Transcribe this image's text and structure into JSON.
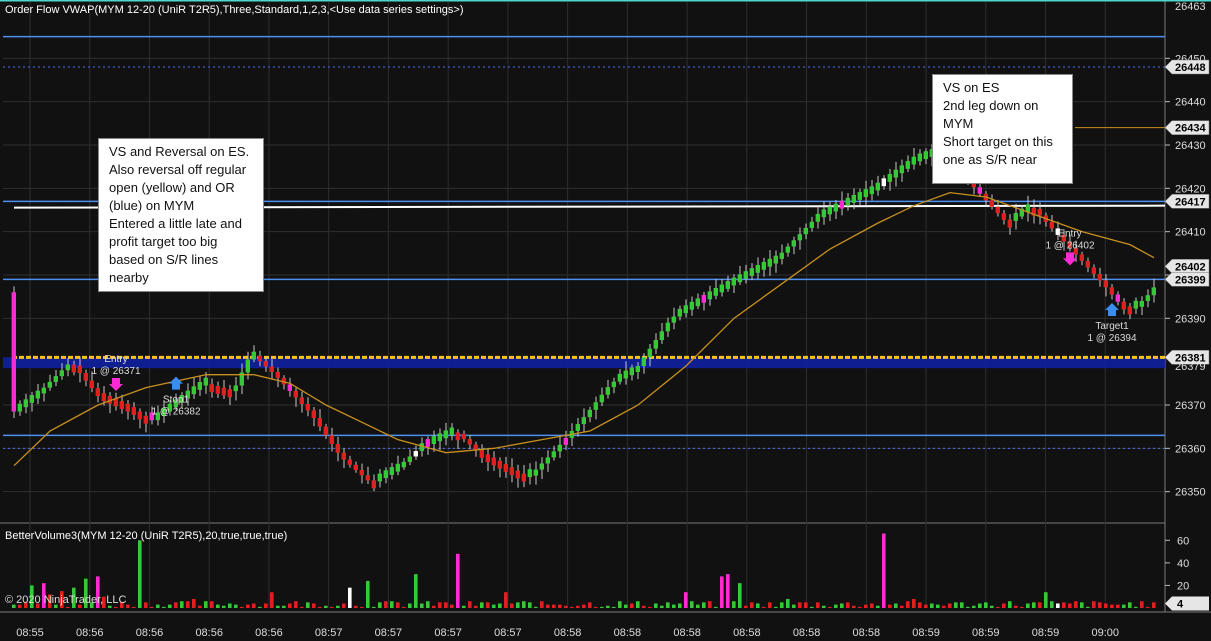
{
  "window": {
    "price_indicator_label": "Order Flow VWAP(MYM 12-20 (UniR T2R5),Three,Standard,1,2,3,<Use data series settings>)",
    "volume_indicator_label": "BetterVolume3(MYM 12-20 (UniR T2R5),20,true,true,true)",
    "copyright": "© 2020 NinjaTrader, LLC"
  },
  "colors": {
    "background": "#111111",
    "grid": "#2e2e2e",
    "up_bar": "#37c837",
    "down_bar": "#e02020",
    "climax_bar": "#ff2ad4",
    "neutral_bar": "#ffffff",
    "vwap": "#c8901e",
    "sr_line": "#4f8ff0",
    "open_line": "#ffc21a",
    "or_band": "#1020a0",
    "axis_tag_bg": "#e6e6e6",
    "note_bg": "#ffffff"
  },
  "notes": [
    {
      "id": "left",
      "text": "VS and Reversal on ES.\nAlso reversal off regular open (yellow) and OR (blue) on MYM\nEntered a little late and profit target too big based on S/R lines nearby"
    },
    {
      "id": "right",
      "text": "VS on ES\n2nd leg down on MYM\nShort target on this one as S/R near"
    }
  ],
  "trade_markers": [
    {
      "id": "entry-left",
      "label": "Entry",
      "detail": "1 @ 26371",
      "arrow": "down",
      "arrow_color": "#ff2ad4",
      "bar": 17,
      "price": 26373
    },
    {
      "id": "stop-left",
      "label": "Stop1",
      "detail": "1 @ 26382",
      "arrow": "up",
      "arrow_color": "#3a8ef0",
      "bar": 27,
      "price": 26377
    },
    {
      "id": "entry-right",
      "label": "Entry",
      "detail": "1 @ 26402",
      "arrow": "down",
      "arrow_color": "#ff2ad4",
      "bar": 176,
      "price": 26402
    },
    {
      "id": "target-right",
      "label": "Target1",
      "detail": "1 @ 26394",
      "arrow": "up",
      "arrow_color": "#3a8ef0",
      "bar": 183,
      "price": 26394
    }
  ],
  "chart_data": {
    "type": "candlestick",
    "y_range": [
      26343,
      26463
    ],
    "y_ticks": [
      26350,
      26360,
      26370,
      26390,
      26400,
      26410,
      26420,
      26430,
      26440,
      26450
    ],
    "price_tags": [
      {
        "value": 26463,
        "type": "plain"
      },
      {
        "value": 26448,
        "type": "tag"
      },
      {
        "value": 26434,
        "type": "tag"
      },
      {
        "value": 26417,
        "type": "tag"
      },
      {
        "value": 26402,
        "type": "tag"
      },
      {
        "value": 26399,
        "type": "tag"
      },
      {
        "value": 26381,
        "type": "tag"
      },
      {
        "value": 26379,
        "type": "plain"
      }
    ],
    "levels": [
      {
        "price": 26455,
        "style": "sr"
      },
      {
        "price": 26448,
        "style": "dotted"
      },
      {
        "price": 26434,
        "style": "vwap-right"
      },
      {
        "price": 26417,
        "style": "sr"
      },
      {
        "price": 26416,
        "style": "white"
      },
      {
        "price": 26399,
        "style": "sr"
      },
      {
        "price": 26381,
        "style": "open"
      },
      {
        "price": 26363,
        "style": "sr"
      },
      {
        "price": 26360,
        "style": "dotted"
      }
    ],
    "or_band": [
      26378.5,
      26381
    ],
    "x_labels": [
      "08:55",
      "08:56",
      "08:56",
      "08:56",
      "08:56",
      "08:57",
      "08:57",
      "08:57",
      "08:57",
      "08:58",
      "08:58",
      "08:58",
      "08:58",
      "08:58",
      "08:58",
      "08:59",
      "08:59",
      "08:59",
      "09:00"
    ],
    "path": [
      [
        0,
        26368
      ],
      [
        4,
        26372
      ],
      [
        10,
        26380
      ],
      [
        14,
        26373
      ],
      [
        19,
        26370
      ],
      [
        23,
        26366
      ],
      [
        28,
        26371
      ],
      [
        32,
        26375
      ],
      [
        37,
        26373
      ],
      [
        40,
        26382
      ],
      [
        44,
        26377
      ],
      [
        50,
        26368
      ],
      [
        55,
        26358
      ],
      [
        60,
        26352
      ],
      [
        64,
        26355
      ],
      [
        68,
        26360
      ],
      [
        74,
        26364
      ],
      [
        78,
        26359
      ],
      [
        82,
        26356
      ],
      [
        86,
        26353
      ],
      [
        91,
        26360
      ],
      [
        96,
        26368
      ],
      [
        100,
        26375
      ],
      [
        104,
        26378
      ],
      [
        110,
        26390
      ],
      [
        120,
        26398
      ],
      [
        127,
        26403
      ],
      [
        134,
        26413
      ],
      [
        143,
        26419
      ],
      [
        150,
        26426
      ],
      [
        154,
        26428
      ],
      [
        158,
        26424
      ],
      [
        162,
        26418
      ],
      [
        166,
        26412
      ],
      [
        170,
        26416
      ],
      [
        174,
        26410
      ],
      [
        178,
        26404
      ],
      [
        182,
        26398
      ],
      [
        185,
        26393
      ],
      [
        187,
        26392
      ],
      [
        190,
        26396
      ]
    ],
    "vwap": [
      [
        0,
        26356
      ],
      [
        6,
        26364
      ],
      [
        14,
        26370
      ],
      [
        22,
        26374
      ],
      [
        32,
        26377
      ],
      [
        40,
        26377
      ],
      [
        46,
        26375
      ],
      [
        52,
        26370
      ],
      [
        58,
        26366
      ],
      [
        64,
        26362
      ],
      [
        72,
        26359
      ],
      [
        80,
        26360
      ],
      [
        88,
        26362
      ],
      [
        96,
        26364
      ],
      [
        104,
        26370
      ],
      [
        112,
        26379
      ],
      [
        120,
        26390
      ],
      [
        128,
        26398
      ],
      [
        136,
        26406
      ],
      [
        144,
        26412
      ],
      [
        150,
        26416
      ],
      [
        156,
        26419
      ],
      [
        162,
        26418
      ],
      [
        170,
        26414
      ],
      [
        178,
        26410
      ],
      [
        186,
        26407
      ],
      [
        190,
        26404
      ]
    ],
    "volume": {
      "y_range": [
        0,
        70
      ],
      "y_ticks": [
        20,
        40,
        60
      ],
      "last_value": "4",
      "spikes": [
        {
          "bar": 3,
          "value": 20,
          "kind": "up"
        },
        {
          "bar": 5,
          "value": 22,
          "kind": "climax"
        },
        {
          "bar": 6,
          "value": 12,
          "kind": "down"
        },
        {
          "bar": 8,
          "value": 15,
          "kind": "down"
        },
        {
          "bar": 10,
          "value": 18,
          "kind": "up"
        },
        {
          "bar": 12,
          "value": 26,
          "kind": "up"
        },
        {
          "bar": 14,
          "value": 28,
          "kind": "climax"
        },
        {
          "bar": 15,
          "value": 10,
          "kind": "down"
        },
        {
          "bar": 21,
          "value": 60,
          "kind": "up"
        },
        {
          "bar": 30,
          "value": 8,
          "kind": "down"
        },
        {
          "bar": 43,
          "value": 14,
          "kind": "down"
        },
        {
          "bar": 56,
          "value": 18,
          "kind": "neutral"
        },
        {
          "bar": 59,
          "value": 24,
          "kind": "up"
        },
        {
          "bar": 67,
          "value": 30,
          "kind": "up"
        },
        {
          "bar": 74,
          "value": 48,
          "kind": "climax"
        },
        {
          "bar": 82,
          "value": 14,
          "kind": "down"
        },
        {
          "bar": 112,
          "value": 14,
          "kind": "climax"
        },
        {
          "bar": 118,
          "value": 28,
          "kind": "climax"
        },
        {
          "bar": 119,
          "value": 30,
          "kind": "climax"
        },
        {
          "bar": 121,
          "value": 22,
          "kind": "up"
        },
        {
          "bar": 129,
          "value": 8,
          "kind": "up"
        },
        {
          "bar": 145,
          "value": 66,
          "kind": "climax"
        },
        {
          "bar": 150,
          "value": 8,
          "kind": "down"
        },
        {
          "bar": 172,
          "value": 14,
          "kind": "up"
        },
        {
          "bar": 174,
          "value": 4,
          "kind": "neutral"
        }
      ]
    }
  }
}
